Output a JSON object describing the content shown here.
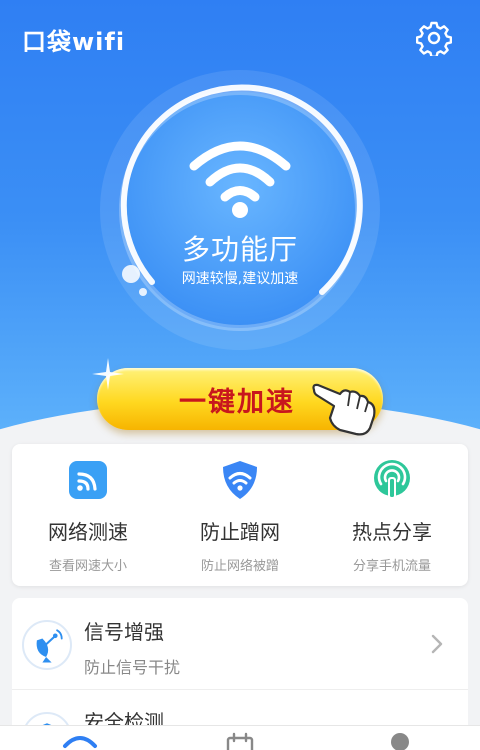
{
  "app": {
    "title": "口袋wifi"
  },
  "header": {
    "settings_icon": "gear-icon"
  },
  "hero": {
    "network_name": "多功能厅",
    "hint": "网速较慢,建议加速",
    "boost_button": "一键加速",
    "wifi_icon": "wifi-icon"
  },
  "features": [
    {
      "title": "网络测速",
      "subtitle": "查看网速大小",
      "icon": "speedtest-icon",
      "color": "#3aa0f5"
    },
    {
      "title": "防止蹭网",
      "subtitle": "防止网络被蹭",
      "icon": "shield-wifi-icon",
      "color": "#3a86f5"
    },
    {
      "title": "热点分享",
      "subtitle": "分享手机流量",
      "icon": "hotspot-icon",
      "color": "#2ec79a"
    }
  ],
  "list": [
    {
      "title": "信号增强",
      "subtitle": "防止信号干扰",
      "icon": "satellite-dish-icon"
    },
    {
      "title": "安全检测",
      "subtitle": "",
      "icon": "security-scan-icon"
    }
  ],
  "tabbar": {
    "icons": [
      "wifi-tab-icon",
      "calendar-tab-icon",
      "profile-tab-icon"
    ]
  },
  "colors": {
    "primary": "#3b8ff5",
    "button": "#ffd820",
    "button_text": "#c8161d"
  }
}
